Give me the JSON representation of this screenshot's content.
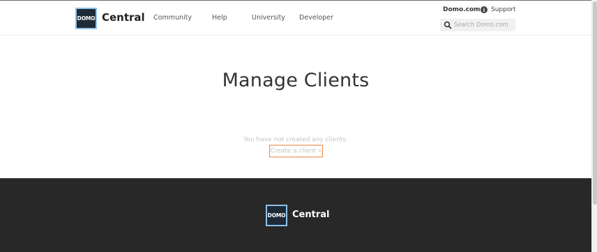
{
  "header": {
    "logo_text": "DOMO",
    "brand": "Central",
    "nav": [
      "Community",
      "Help",
      "University",
      "Developer"
    ],
    "domo_link": "Domo.com",
    "support": "Support",
    "search_placeholder": "Search Domo.com"
  },
  "main": {
    "title": "Manage Clients",
    "empty_message": "You have not created any clients.",
    "create_link": "Create a client »"
  },
  "footer": {
    "logo_text": "DOMO",
    "brand": "Central"
  },
  "colors": {
    "logo_bg": "#1e2a36",
    "logo_border": "#8fc3ea",
    "footer_bg": "#282828",
    "highlight": "#f0843c"
  }
}
